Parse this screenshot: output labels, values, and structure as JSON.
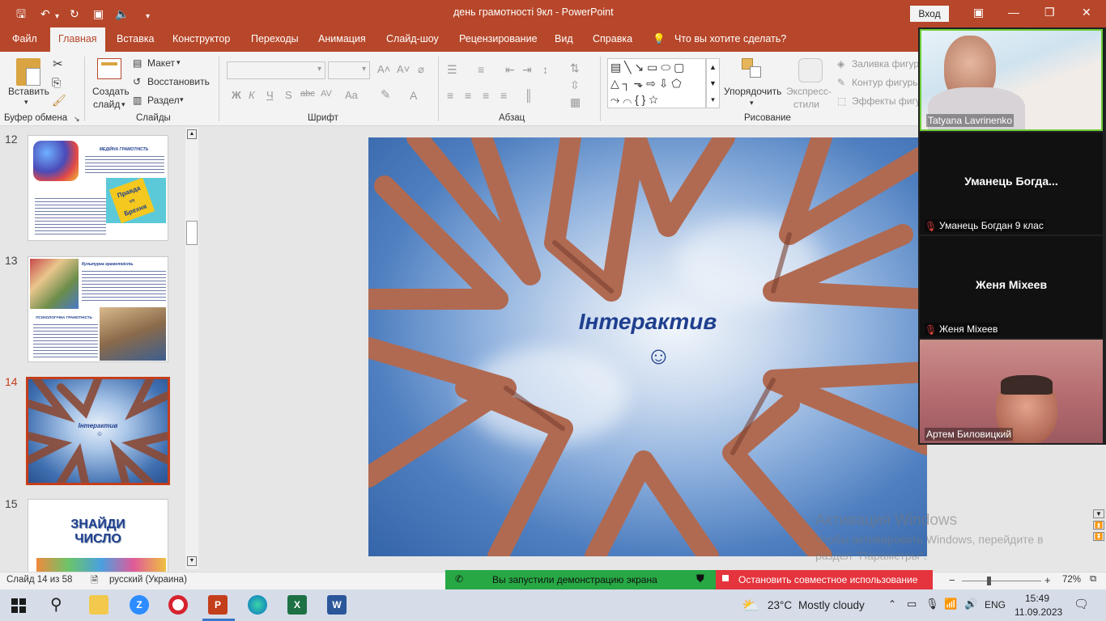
{
  "titlebar": {
    "doc_title": "день грамотності 9кл",
    "app_sep": "-",
    "app_name": "PowerPoint",
    "signin": "Вход"
  },
  "tabs": [
    {
      "label": "Файл"
    },
    {
      "label": "Главная"
    },
    {
      "label": "Вставка"
    },
    {
      "label": "Конструктор"
    },
    {
      "label": "Переходы"
    },
    {
      "label": "Анимация"
    },
    {
      "label": "Слайд-шоу"
    },
    {
      "label": "Рецензирование"
    },
    {
      "label": "Вид"
    },
    {
      "label": "Справка"
    }
  ],
  "tellme": "Что вы хотите сделать?",
  "ribbon": {
    "paste": "Вставить",
    "clipboard_group": "Буфер обмена",
    "new_slide_l1": "Создать",
    "new_slide_l2": "слайд",
    "layout": "Макет",
    "reset": "Восстановить",
    "section": "Раздел",
    "slides_group": "Слайды",
    "font_group": "Шрифт",
    "para_group": "Абзац",
    "arrange": "Упорядочить",
    "quick_styles_l1": "Экспресс-",
    "quick_styles_l2": "стили",
    "shape_fill": "Заливка фигуры",
    "shape_outline": "Контур фигуры",
    "shape_effects": "Эффекты фигуры",
    "drawing_group": "Рисование"
  },
  "thumbnails": {
    "n12": "12",
    "n13": "13",
    "n14": "14",
    "n15": "15",
    "t12_head": "МЕДІЙНА ГРАМОТНІСТЬ",
    "t12_badge_1": "Правда",
    "t12_badge_2": "vs",
    "t12_badge_3": "Брехня",
    "t13_head": "Культурна грамотність",
    "t13_sub": "ПСИХОЛОГІЧНА ГРАМОТНІСТЬ",
    "t14_title": "Інтерактив",
    "t15_title_1": "ЗНАЙДИ",
    "t15_title_2": "ЧИСЛО"
  },
  "slide": {
    "title": "Інтерактив",
    "smiley": "☺"
  },
  "watermark": {
    "line1": "Активация Windows",
    "line2": "Чтобы активировать Windows, перейдите в раздел \"Параметры\"."
  },
  "participants": [
    {
      "name": "Tatyana Lavrinenko"
    },
    {
      "big": "Уманець  Богда...",
      "name": "Уманець Богдан 9 клас"
    },
    {
      "big": "Женя Міхеев",
      "name": "Женя Міхеев"
    },
    {
      "name": "Артем Биловицкий"
    }
  ],
  "status": {
    "slide_info": "Слайд 14 из 58",
    "language": "русский (Украина)",
    "zoom": "72%"
  },
  "share": {
    "green": "Вы запустили демонстрацию экрана",
    "red": "Остановить совместное использование"
  },
  "taskbar": {
    "weather_temp": "23°C",
    "weather_text": "Mostly cloudy",
    "lang": "ENG",
    "time": "15:49",
    "date": "11.09.2023"
  },
  "colors": {
    "accent": "#b7472a",
    "current_slide": "#c43e1c",
    "share_green": "#27a844",
    "share_red": "#e5343d"
  }
}
